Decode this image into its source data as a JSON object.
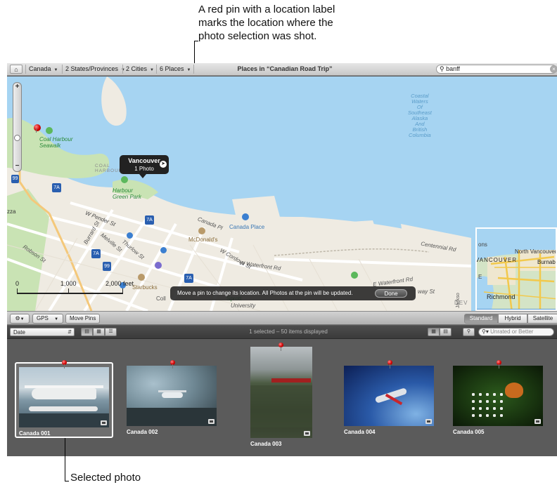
{
  "callouts": {
    "top_lines": [
      "A red pin with a location label",
      "marks the location where the",
      "photo selection was shot."
    ],
    "bottom": "Selected photo"
  },
  "toolbar": {
    "home_icon": "home-icon",
    "breadcrumbs": [
      {
        "label": "Canada"
      },
      {
        "label": "2 States/Provinces"
      },
      {
        "label": "2 Cities"
      },
      {
        "label": "6 Places"
      }
    ],
    "title": "Places in “Canadian Road Trip”",
    "search_value": "banff"
  },
  "map": {
    "tooltip_title": "Vancouver",
    "tooltip_subtitle": "1 Photo",
    "labels": {
      "coal_harbour": "COAL\nHARBOUR",
      "coal_harbour_seawalk": "Coal Harbour\nSeawalk",
      "harbour_green_park": "Harbour\nGreen Park",
      "canada_place": "Canada Place",
      "mcdonalds": "McDonald's",
      "starbucks": "Starbucks",
      "w_pender": "W Pender St",
      "canada_pl": "Canada Pl",
      "w_waterfront": "W Waterfront Rd",
      "e_waterfront": "E Waterfront Rd",
      "centennial": "Centennial Rd",
      "robson": "Robson St",
      "thurlow": "Thurlow St",
      "melville": "Melville St",
      "burrard": "Burrard St",
      "cordova": "W Cordova St",
      "sproat": "Sprott",
      "coll": "Coll",
      "university": "University",
      "way_st": "way St",
      "dev": "DEV",
      "zza": "zza",
      "jackson": "Jackso",
      "coastal_waters": "Coastal\nWaters\nOf\nSoutheast\nAlaska\nAnd\nBritish\nColumbia"
    },
    "route_shields": [
      "99",
      "7A",
      "7A",
      "99",
      "7A",
      "7A"
    ],
    "scale": {
      "ticks": [
        "0",
        "1,000",
        "2,000 feet"
      ]
    },
    "inset_labels": {
      "north_vancouver": "North Vancouver",
      "vancouver": "VANCOUVER",
      "burnaby": "Burnab",
      "richmond": "Richmond",
      "ons": "ons",
      "e": "E"
    },
    "message": "Move a pin to change its location. All Photos at the pin will be updated.",
    "done_label": "Done"
  },
  "map_controls": {
    "gear_icon": "gear-icon",
    "gps_label": "GPS",
    "move_pins_label": "Move Pins",
    "map_types": [
      "Standard",
      "Hybrid",
      "Satellite"
    ],
    "selected_map_type": "Standard"
  },
  "browser_bar": {
    "sort_value": "Date",
    "status": "1 selected – 50 items displayed",
    "filter_placeholder": "Unrated or Better"
  },
  "photos": [
    {
      "name": "Canada 001",
      "selected": true,
      "subject": "seaplane"
    },
    {
      "name": "Canada 002",
      "selected": false,
      "subject": "seaplane-flying"
    },
    {
      "name": "Canada 003",
      "selected": false,
      "subject": "train-landscape"
    },
    {
      "name": "Canada 004",
      "selected": false,
      "subject": "jet"
    },
    {
      "name": "Canada 005",
      "selected": false,
      "subject": "butterfly"
    }
  ],
  "colors": {
    "water": "#a6d4f2",
    "land": "#efebe2",
    "park": "#c9e3b4",
    "pin_red": "#d10000",
    "browser_bg": "#5b5b5b"
  }
}
